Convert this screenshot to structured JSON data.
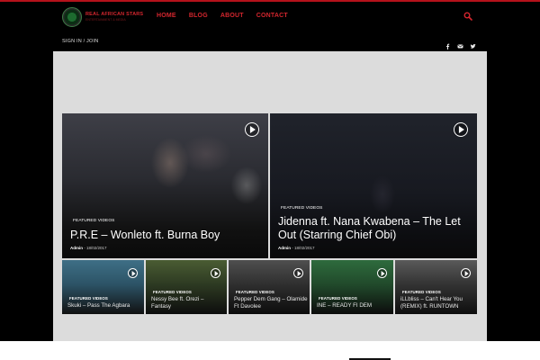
{
  "site": {
    "logo_name": "REAL AFRICAN STARS",
    "logo_tag": "ENTERTAINMENT & MEDIA"
  },
  "nav": [
    {
      "label": "HOME"
    },
    {
      "label": "BLOG"
    },
    {
      "label": "ABOUT"
    },
    {
      "label": "CONTACT"
    }
  ],
  "subbar": {
    "signin": "SIGN IN / JOIN"
  },
  "icons": {
    "search": "search-icon",
    "social": [
      "facebook-icon",
      "mail-icon",
      "twitter-icon"
    ]
  },
  "colors": {
    "accent": "#d4262e",
    "topline": "#b5121b"
  },
  "featured": [
    {
      "category": "FEATURED VIDEOS",
      "title": "P.R.E – Wonleto ft. Burna Boy",
      "author": "Admin",
      "date": "18/02/2017"
    },
    {
      "category": "FEATURED VIDEOS",
      "title": "Jidenna ft. Nana Kwabena – The Let Out (Starring Chief Obi)",
      "author": "Admin",
      "date": "18/02/2017"
    }
  ],
  "small": [
    {
      "category": "FEATURED VIDEOS",
      "title": "Skuki – Pass The Agbara"
    },
    {
      "category": "FEATURED VIDEOS",
      "title": "Nessy Bee ft. Orezi – Fantasy"
    },
    {
      "category": "FEATURED VIDEOS",
      "title": "Pepper Dem Gang – Olamide Ft Davolee"
    },
    {
      "category": "FEATURED VIDEOS",
      "title": "INE – READY FI DEM"
    },
    {
      "category": "FEATURED VIDEOS",
      "title": "iLLbliss – Can't Hear You (REMIX) ft. RUNTOWN"
    }
  ]
}
